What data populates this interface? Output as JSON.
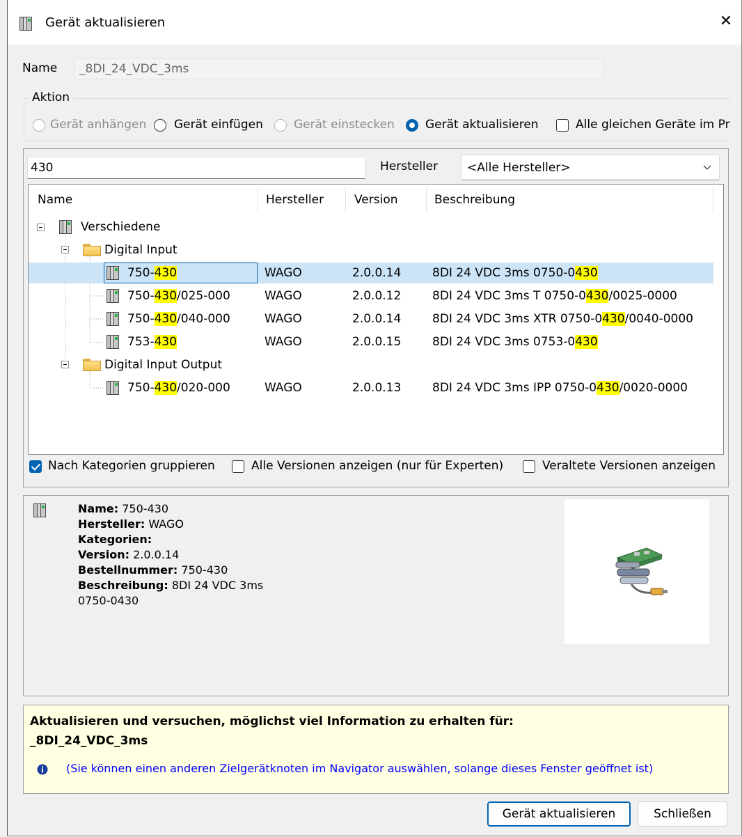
{
  "window": {
    "title": "Gerät aktualisieren",
    "close_glyph": "✕"
  },
  "name_field": {
    "label": "Name",
    "value": "_8DI_24_VDC_3ms"
  },
  "action_group": {
    "label": "Aktion",
    "options": [
      {
        "label": "Gerät anhängen",
        "enabled": false,
        "selected": false
      },
      {
        "label": "Gerät einfügen",
        "enabled": true,
        "selected": false
      },
      {
        "label": "Gerät einstecken",
        "enabled": false,
        "selected": false
      },
      {
        "label": "Gerät aktualisieren",
        "enabled": true,
        "selected": true
      }
    ],
    "checkbox_label": "Alle gleichen Geräte im Pr"
  },
  "search": {
    "value": "430",
    "vendor_label": "Hersteller",
    "vendor_selected": "<Alle Hersteller>"
  },
  "table": {
    "columns": [
      "Name",
      "Hersteller",
      "Version",
      "Beschreibung"
    ],
    "root": "Verschiedene",
    "groups": [
      {
        "name": "Digital Input",
        "items": [
          {
            "name_pre": "750-",
            "name_hl": "430",
            "name_post": "",
            "vendor": "WAGO",
            "version": "2.0.0.14",
            "desc_pre": "8DI 24 VDC 3ms  0750-0",
            "desc_hl": "430",
            "desc_post": "",
            "selected": true
          },
          {
            "name_pre": "750-",
            "name_hl": "430",
            "name_post": "/025-000",
            "vendor": "WAGO",
            "version": "2.0.0.12",
            "desc_pre": "8DI 24 VDC 3ms T  0750-0",
            "desc_hl": "430",
            "desc_post": "/0025-0000"
          },
          {
            "name_pre": "750-",
            "name_hl": "430",
            "name_post": "/040-000",
            "vendor": "WAGO",
            "version": "2.0.0.14",
            "desc_pre": "8DI 24 VDC 3ms XTR  0750-0",
            "desc_hl": "430",
            "desc_post": "/0040-0000"
          },
          {
            "name_pre": "753-",
            "name_hl": "430",
            "name_post": "",
            "vendor": "WAGO",
            "version": "2.0.0.15",
            "desc_pre": "8DI 24 VDC 3ms  0753-0",
            "desc_hl": "430",
            "desc_post": ""
          }
        ]
      },
      {
        "name": "Digital Input Output",
        "items": [
          {
            "name_pre": "750-",
            "name_hl": "430",
            "name_post": "/020-000",
            "vendor": "WAGO",
            "version": "2.0.0.13",
            "desc_pre": "8DI 24 VDC 3ms IPP  0750-0",
            "desc_hl": "430",
            "desc_post": "/0020-0000"
          }
        ]
      }
    ]
  },
  "filters": {
    "group_by_category": {
      "label": "Nach Kategorien gruppieren",
      "checked": true
    },
    "all_versions": {
      "label": "Alle Versionen anzeigen (nur für Experten)",
      "checked": false
    },
    "outdated_versions": {
      "label": "Veraltete Versionen anzeigen",
      "checked": false
    }
  },
  "details": {
    "name_label": "Name:",
    "name": "750-430",
    "vendor_label": "Hersteller:",
    "vendor": "WAGO",
    "categories_label": "Kategorien:",
    "categories": "",
    "version_label": "Version:",
    "version": "2.0.0.14",
    "order_label": "Bestellnummer:",
    "order": "750-430",
    "desc_label": "Beschreibung:",
    "desc": "8DI 24 VDC 3ms",
    "desc_line2": "0750-0430"
  },
  "info_box": {
    "heading": "Aktualisieren und versuchen, möglichst viel Information zu erhalten für:",
    "target": "_8DI_24_VDC_3ms",
    "hint": "(Sie können einen anderen Zielgerätknoten im Navigator auswählen, solange dieses Fenster geöffnet ist)"
  },
  "buttons": {
    "update": "Gerät aktualisieren",
    "close": "Schließen"
  },
  "colors": {
    "accent": "#0063b1",
    "selection": "#cce4f7",
    "highlight": "#ffff00",
    "info_bg": "#ffffe1",
    "hint_text": "#0000ff"
  }
}
